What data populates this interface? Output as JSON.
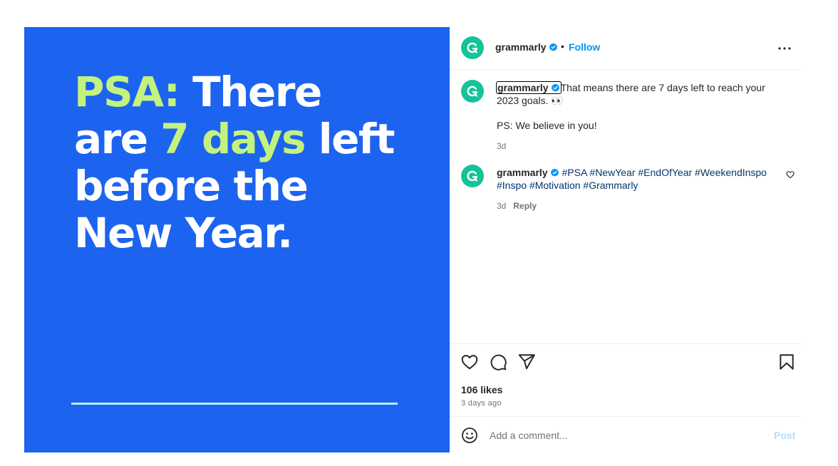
{
  "media": {
    "headline": {
      "l1a": "PSA:",
      "l1b": " There",
      "l2a": "are ",
      "l2b": "7 days",
      "l2c": " left",
      "l3": "before the",
      "l4": "New Year."
    },
    "colors": {
      "background": "#1c63f0",
      "highlight": "#c4f27f",
      "text": "#ffffff",
      "rule": "#b6ecf6"
    }
  },
  "header": {
    "username": "grammarly",
    "separator": "•",
    "follow_label": "Follow",
    "icons": {
      "avatar": "grammarly-logo-icon",
      "verified": "verified-badge-icon",
      "more": "more-options-icon"
    }
  },
  "comments": [
    {
      "username": "grammarly",
      "text": "That means there are 7 days left to reach your 2023 goals. 👀",
      "text2": "PS: We believe in you!",
      "time": "3d"
    },
    {
      "username": "grammarly",
      "tags": [
        "#PSA",
        "#NewYear",
        "#EndOfYear",
        "#WeekendInspo",
        "#Inspo",
        "#Motivation",
        "#Grammarly"
      ],
      "time": "3d",
      "reply_label": "Reply"
    }
  ],
  "actions": {
    "icons": [
      "heart-icon",
      "comment-icon",
      "share-icon",
      "bookmark-icon"
    ],
    "likes": "106 likes",
    "time_ago": "3 days ago"
  },
  "add_comment": {
    "placeholder": "Add a comment...",
    "post_label": "Post",
    "emoji_icon": "emoji-icon"
  },
  "colors": {
    "accent": "#0095f6",
    "hashtag": "#00376b",
    "avatar": "#15c39a",
    "muted": "#737373"
  }
}
